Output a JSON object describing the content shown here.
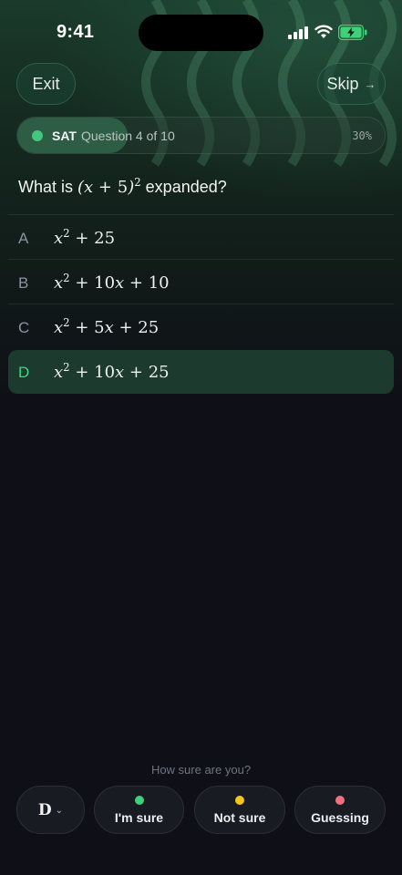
{
  "status_bar": {
    "time": "9:41"
  },
  "header": {
    "exit_label": "Exit",
    "skip_label": "Skip",
    "skip_icon": "arrow-right-icon"
  },
  "progress": {
    "subject": "SAT",
    "question_text": "Question 4 of 10",
    "percent_label": "30%",
    "fraction": 0.3
  },
  "question": {
    "prefix": "What is ",
    "math": "(x + 5)²",
    "suffix": " expanded?"
  },
  "options": [
    {
      "letter": "A",
      "expr": "x² + 25",
      "selected": false
    },
    {
      "letter": "B",
      "expr": "x² + 10x + 10",
      "selected": false
    },
    {
      "letter": "C",
      "expr": "x² + 5x + 25",
      "selected": false
    },
    {
      "letter": "D",
      "expr": "x² + 10x + 25",
      "selected": true
    }
  ],
  "confidence": {
    "prompt": "How sure are you?",
    "selected_answer": "D",
    "choices": [
      {
        "label": "I'm sure",
        "color": "#3fd07a"
      },
      {
        "label": "Not sure",
        "color": "#f5c518"
      },
      {
        "label": "Guessing",
        "color": "#f0707e"
      }
    ]
  },
  "colors": {
    "accent": "#49d27f",
    "selected_bg": "#1c3a2e"
  }
}
